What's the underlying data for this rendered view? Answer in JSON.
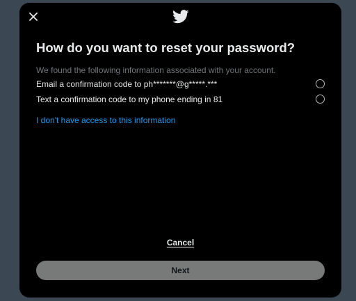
{
  "dialog": {
    "title": "How do you want to reset your password?",
    "subtitle": "We found the following information associated with your account.",
    "options": [
      {
        "label": "Email a confirmation code to ph*******@g*****.***",
        "selected": false
      },
      {
        "label": "Text a confirmation code to my phone ending in 81",
        "selected": false
      }
    ],
    "no_access_link": "I don't have access to this information",
    "cancel_label": "Cancel",
    "next_label": "Next"
  },
  "icons": {
    "close": "close-icon",
    "logo": "twitter-bird-icon"
  },
  "colors": {
    "backdrop": "#3b4752",
    "modal_bg": "#000000",
    "primary_text": "#e7e9ea",
    "secondary_text": "#71767b",
    "link": "#1d9bf0",
    "button_disabled_bg": "#787a7a"
  }
}
